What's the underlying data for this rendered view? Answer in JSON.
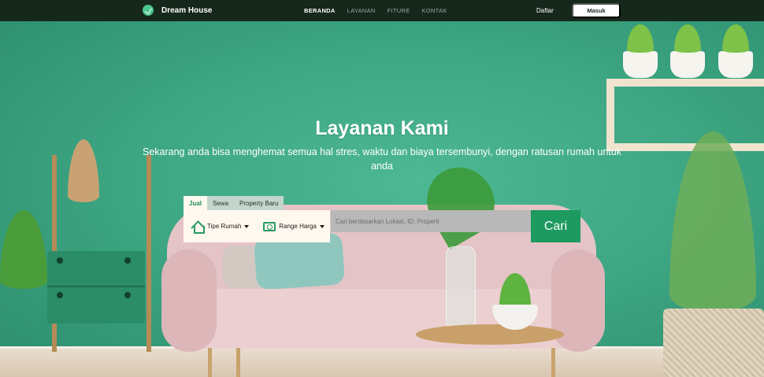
{
  "navbar": {
    "brand": "Dream House",
    "links": [
      {
        "label": "BERANDA",
        "active": true
      },
      {
        "label": "LAYANAN",
        "active": false
      },
      {
        "label": "FITURE",
        "active": false
      },
      {
        "label": "KONTAK",
        "active": false
      }
    ],
    "register_label": "Daftar",
    "login_label": "Masuk"
  },
  "hero": {
    "title": "Layanan Kami",
    "subtitle": "Sekarang anda bisa menghemat semua hal stres, waktu dan biaya tersembunyi, dengan ratusan rumah untuk anda"
  },
  "search": {
    "tabs": [
      {
        "label": "Jual",
        "active": true
      },
      {
        "label": "Sewa",
        "active": false
      },
      {
        "label": "Property Baru",
        "active": false
      }
    ],
    "filters": {
      "type_label": "Tipe Rumah",
      "type_icon": "house-icon",
      "price_label": "Range Harga",
      "price_icon": "money-icon"
    },
    "placeholder": "Cari berdasarkan Lokasi, ID, Properti",
    "submit_label": "Cari"
  },
  "colors": {
    "navbar_bg": "#16281c",
    "hero_wall": "#3ea784",
    "accent_green": "#1d9a5f",
    "filter_bg": "#fff8ee"
  }
}
